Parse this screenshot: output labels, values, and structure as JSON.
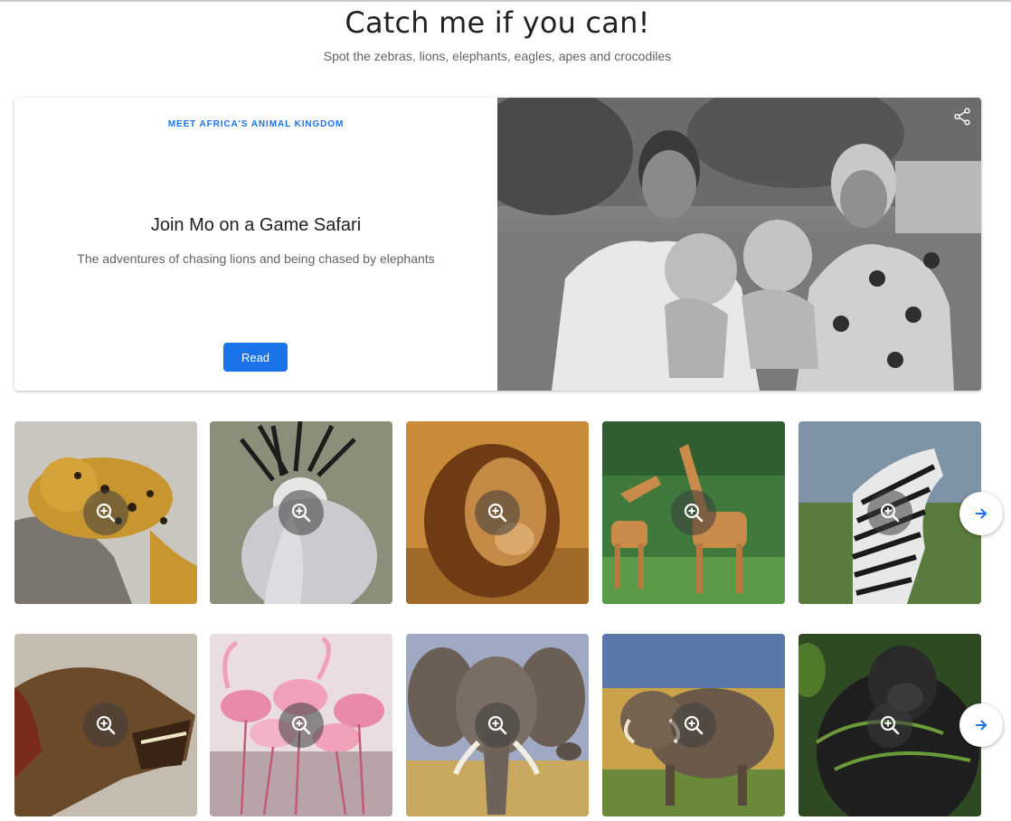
{
  "page": {
    "title": "Catch me if you can!",
    "subtitle": "Spot the zebras, lions, elephants, eagles, apes and crocodiles"
  },
  "feature": {
    "eyebrow": "MEET AFRICA'S ANIMAL KINGDOM",
    "title": "Join Mo on a Game Safari",
    "description": "The adventures of chasing lions and being chased by elephants",
    "read_label": "Read",
    "photo": "black-and-white photo of a man and woman holding two lion cubs",
    "share_icon": "share-icon"
  },
  "gallery": {
    "rows": [
      {
        "tiles": [
          "leopard",
          "secretary-bird",
          "lion",
          "giraffes",
          "zebras"
        ]
      },
      {
        "tiles": [
          "hyena",
          "flamingos",
          "elephant",
          "warthog",
          "gorilla"
        ]
      }
    ],
    "zoom_icon": "zoom-in-icon",
    "next_icon": "arrow-right-icon"
  },
  "colors": {
    "accent": "#1a73e8",
    "text": "#202124",
    "muted": "#5f6368"
  }
}
